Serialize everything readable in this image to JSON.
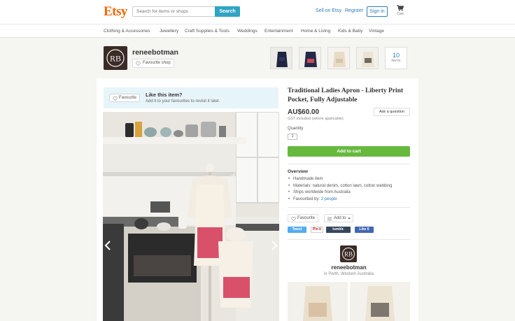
{
  "header": {
    "logo": "Etsy",
    "search_placeholder": "Search for items or shops",
    "search_button": "Search",
    "sell_link": "Sell on Etsy",
    "register_link": "Register",
    "signin_button": "Sign in",
    "cart_label": "Cart"
  },
  "categories": [
    "Clothing & Accessories",
    "Jewellery",
    "Craft Supplies & Tools",
    "Weddings",
    "Entertainment",
    "Home & Living",
    "Kids & Baby",
    "Vintage"
  ],
  "shop": {
    "monogram": "RB",
    "name": "reneebotman",
    "favourite_button": "Favourite shop",
    "items_count": "10",
    "items_label": "items",
    "location": "in Perth, Western Australia"
  },
  "like_bar": {
    "button": "Favourite",
    "title": "Like this item?",
    "subtitle": "Add it to your favourites to revisit it later."
  },
  "listing": {
    "title": "Traditional Ladies Apron - Liberty Print Pocket, Fully Adjustable",
    "ask_button": "Ask a question",
    "price": "AU$60.00",
    "tax_note": "GST included (where applicable).",
    "quantity_label": "Quantity",
    "quantity_value": "1",
    "add_to_cart": "Add to cart",
    "overview_heading": "Overview",
    "overview": {
      "item1": "Handmade item",
      "item2": "Materials: natural denim, cotton lawn, cotton webbing",
      "item3": "Ships worldwide from Australia",
      "favourited_prefix": "Favourited by: ",
      "favourited_link": "2 people"
    },
    "favourite_button": "Favourite",
    "add_to_button": "Add to",
    "social": {
      "tweet": "Tweet",
      "pin": "Pin it",
      "tumblr": "tumblr.",
      "like": "Like 6"
    }
  },
  "colors": {
    "brand": "#f56400",
    "accent": "#2fa4c4",
    "cart_green": "#67b93e",
    "link": "#2f7fb6"
  }
}
